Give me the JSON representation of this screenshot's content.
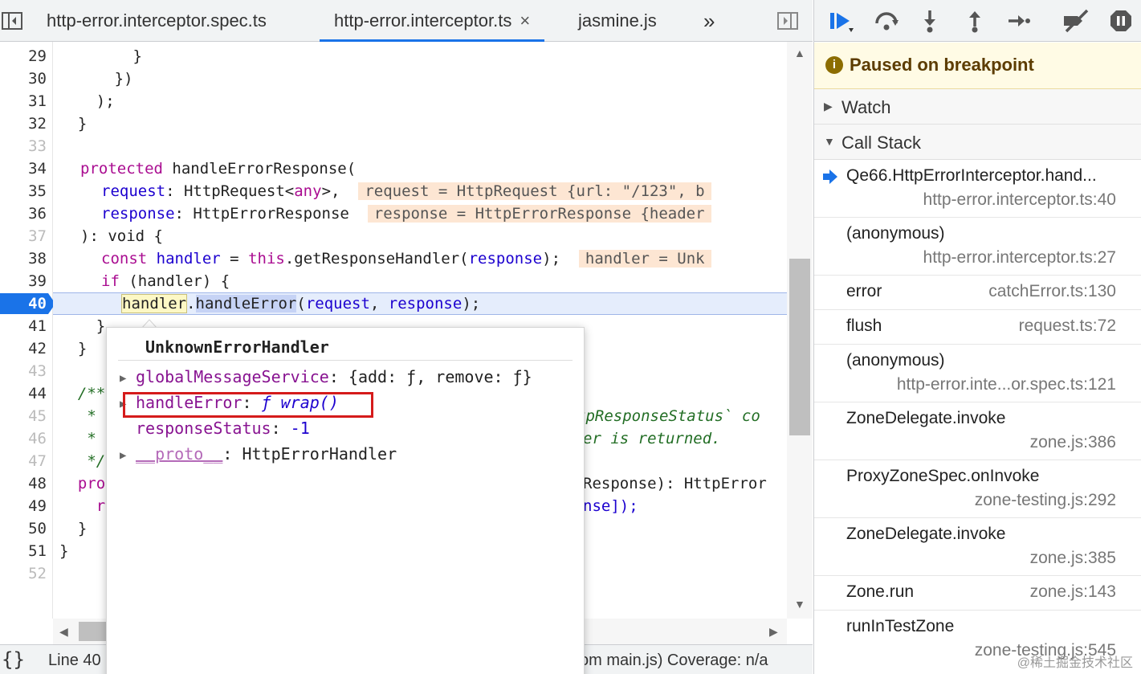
{
  "tabs": [
    {
      "label": "http-error.interceptor.spec.ts",
      "active": false
    },
    {
      "label": "http-error.interceptor.ts",
      "active": true,
      "close": "×"
    },
    {
      "label": "jasmine.js",
      "active": false
    }
  ],
  "tab_overflow": "»",
  "gutter": {
    "lines": [
      "29",
      "30",
      "31",
      "32",
      "33",
      "34",
      "35",
      "36",
      "37",
      "38",
      "39",
      "40",
      "41",
      "42",
      "43",
      "44",
      "45",
      "46",
      "47",
      "48",
      "49",
      "50",
      "51",
      "52"
    ],
    "faded": [
      "33",
      "37",
      "43",
      "45",
      "46",
      "47",
      "52"
    ],
    "breakpoint_line": "40"
  },
  "code": {
    "l29": "        }",
    "l30": "      })",
    "l31": "    );",
    "l32": "  }",
    "l34_kw": "protected",
    "l34_rest": " handleErrorResponse(",
    "l35_a": "request",
    "l35_b": ": HttpRequest<",
    "l35_c": "any",
    "l35_d": ">,",
    "l35_inline": "request = HttpRequest {url: \"/123\", b",
    "l36_a": "response",
    "l36_b": ": HttpErrorResponse",
    "l36_inline": "response = HttpErrorResponse {header",
    "l37": "): void {",
    "l38_kw": "const",
    "l38_var": "handler",
    "l38_eq": " = ",
    "l38_this": "this",
    "l38_rest": ".getResponseHandler(",
    "l38_arg": "response",
    "l38_end": ");",
    "l38_inline": "handler = Unk",
    "l39_kw": "if",
    "l39_rest": " (handler) {",
    "l40_a": "handler",
    "l40_b": ".",
    "l40_c": "handleError",
    "l40_d": "(",
    "l40_e": "request",
    "l40_f": ", ",
    "l40_g": "response",
    "l40_h": ");",
    "l41": "    }",
    "l42": "  }",
    "l44": "  /**",
    "l45": "   *",
    "l45_right": "tpResponseStatus` co",
    "l46": "   *",
    "l46_right": "er is returned.",
    "l47": "   */",
    "l48": "  pro",
    "l48_right": "Response): HttpError",
    "l49": "    r",
    "l49_right": "nse]);",
    "l50": "  }",
    "l51": "}"
  },
  "popover": {
    "title": "UnknownErrorHandler",
    "rows": [
      {
        "key": "globalMessageService",
        "sep": ": ",
        "value": "{add: ƒ, remove: ƒ}",
        "expandable": true
      },
      {
        "key": "handleError",
        "sep": ": ",
        "value": "ƒ wrap()",
        "expandable": true
      },
      {
        "key": "responseStatus",
        "sep": ": ",
        "value": "-1",
        "expandable": false
      },
      {
        "key": "__proto__",
        "sep": ": ",
        "value": "HttpErrorHandler",
        "expandable": true
      }
    ]
  },
  "status": {
    "braces": "{}",
    "line": "Line 40",
    "right": "om main.js)  Coverage: n/a"
  },
  "debugger": {
    "paused_text": "Paused on breakpoint",
    "watch_label": "Watch",
    "callstack_label": "Call Stack",
    "frames": [
      {
        "name": "Qe66.HttpErrorInterceptor.hand...",
        "loc": "http-error.interceptor.ts:40",
        "current": true
      },
      {
        "name": "(anonymous)",
        "loc": "http-error.interceptor.ts:27"
      },
      {
        "name": "error",
        "loc": "catchError.ts:130"
      },
      {
        "name": "flush",
        "loc": "request.ts:72"
      },
      {
        "name": "(anonymous)",
        "loc": "http-error.inte...or.spec.ts:121"
      },
      {
        "name": "ZoneDelegate.invoke",
        "loc": "zone.js:386"
      },
      {
        "name": "ProxyZoneSpec.onInvoke",
        "loc": "zone-testing.js:292"
      },
      {
        "name": "ZoneDelegate.invoke",
        "loc": "zone.js:385"
      },
      {
        "name": "Zone.run",
        "loc": "zone.js:143"
      },
      {
        "name": "runInTestZone",
        "loc": "zone-testing.js:545"
      }
    ]
  },
  "watermark": "@稀土掘金技术社区",
  "colors": {
    "accent": "#1a73e8",
    "breakpoint": "#1a73e8",
    "paused_bg": "#fffbe5",
    "inline_value_bg": "#fde6d3",
    "highlight_red": "#d51b1b"
  }
}
